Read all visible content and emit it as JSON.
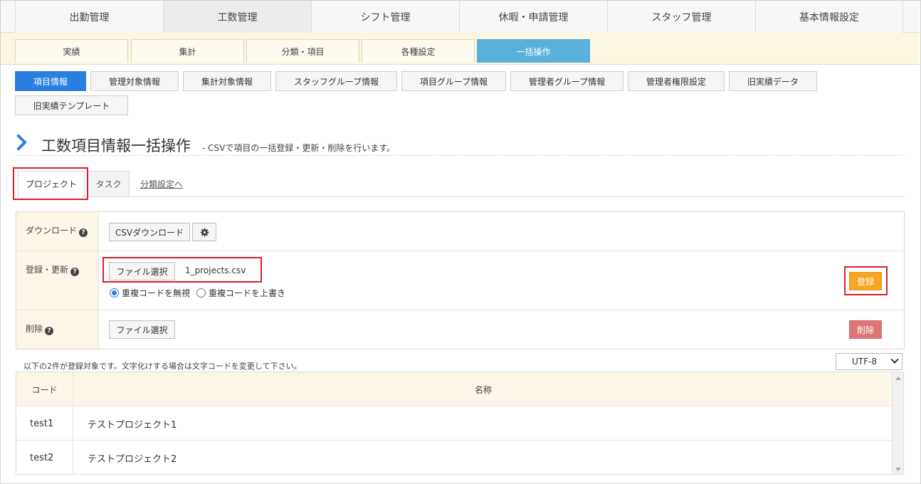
{
  "top_nav": [
    "出勤管理",
    "工数管理",
    "シフト管理",
    "休暇・申請管理",
    "スタッフ管理",
    "基本情報設定"
  ],
  "sub_nav": [
    "実績",
    "集計",
    "分類・項目",
    "各種設定",
    "一括操作"
  ],
  "third_nav": [
    "項目情報",
    "管理対象情報",
    "集計対象情報",
    "スタッフグループ情報",
    "項目グループ情報",
    "管理者グループ情報",
    "管理者権限設定",
    "旧実績データ",
    "旧実績テンプレート"
  ],
  "page": {
    "title": "工数項目情報一括操作",
    "subtitle": "- CSVで項目の一括登録・更新・削除を行います。"
  },
  "tabs": {
    "project": "プロジェクト",
    "task": "タスク",
    "link": "分類設定へ"
  },
  "form": {
    "download": {
      "label": "ダウンロード",
      "button": "CSVダウンロード"
    },
    "register": {
      "label": "登録・更新",
      "file_button": "ファイル選択",
      "file_name": "1_projects.csv",
      "radio_ignore": "重複コードを無視",
      "radio_overwrite": "重複コードを上書き",
      "submit": "登録"
    },
    "delete": {
      "label": "削除",
      "file_button": "ファイル選択",
      "submit": "削除"
    }
  },
  "note": "以下の2件が登録対象です。文字化けする場合は文字コードを変更して下さい。",
  "encoding": "UTF-8",
  "table": {
    "headers": [
      "コード",
      "名称"
    ],
    "rows": [
      {
        "code": "test1",
        "name": "テストプロジェクト1"
      },
      {
        "code": "test2",
        "name": "テストプロジェクト2"
      }
    ]
  }
}
